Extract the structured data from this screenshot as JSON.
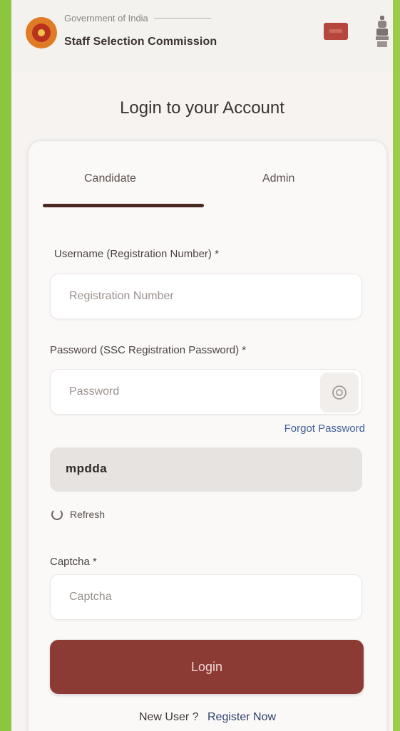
{
  "header": {
    "gov_label": "Government of India",
    "org_title": "Staff Selection Commission",
    "logo_icon": "ssc-logo-icon",
    "flag_icon": "flag-icon",
    "emblem_icon": "national-emblem-icon"
  },
  "page": {
    "title": "Login to your Account"
  },
  "tabs": {
    "candidate": "Candidate",
    "admin": "Admin",
    "active": "Candidate"
  },
  "form": {
    "username_label": "Username (Registration Number) *",
    "username_placeholder": "Registration Number",
    "password_label": "Password (SSC Registration Password) *",
    "password_placeholder": "Password",
    "forgot_password": "Forgot Password",
    "captcha_value": "mpdda",
    "refresh_label": "Refresh",
    "captcha_label": "Captcha *",
    "captcha_placeholder": "Captcha",
    "login_button": "Login"
  },
  "footer": {
    "new_user": "New User ?",
    "register_now": "Register Now"
  },
  "colors": {
    "accent": "#8c3a34",
    "tab_indicator": "#4a2a23",
    "link": "#3f5f9a",
    "side_green": "#8cc63f"
  }
}
